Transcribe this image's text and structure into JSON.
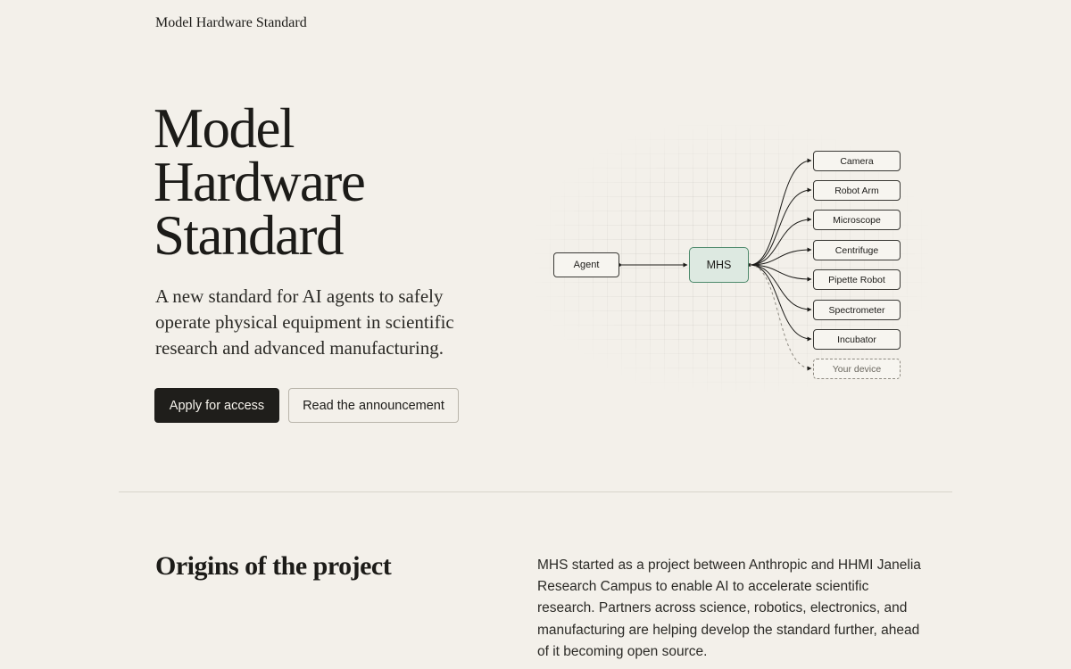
{
  "header": {
    "brand": "Model Hardware Standard"
  },
  "hero": {
    "title_lines": [
      "Model",
      "Hardware",
      "Standard"
    ],
    "subtitle": "A new standard for AI agents to safely operate physical equipment in scientific research and advanced manufacturing.",
    "primary_button": "Apply for access",
    "secondary_button": "Read the announcement"
  },
  "diagram": {
    "agent": "Agent",
    "hub": "MHS",
    "devices": [
      "Camera",
      "Robot Arm",
      "Microscope",
      "Centrifuge",
      "Pipette Robot",
      "Spectrometer",
      "Incubator",
      "Your device"
    ],
    "colors": {
      "hub_fill": "#dde9e1",
      "hub_border": "#4e8a6c"
    }
  },
  "origins": {
    "title": "Origins of the project",
    "body": "MHS started as a project between Anthropic and HHMI Janelia Research Campus to enable AI to accelerate scientific research. Partners across science, robotics, electronics, and manufacturing are helping develop the standard further, ahead of it becoming open source."
  },
  "colors": {
    "background": "#f3f0ea",
    "text": "#1c1b18",
    "primary_button": "#1f1e1b"
  }
}
